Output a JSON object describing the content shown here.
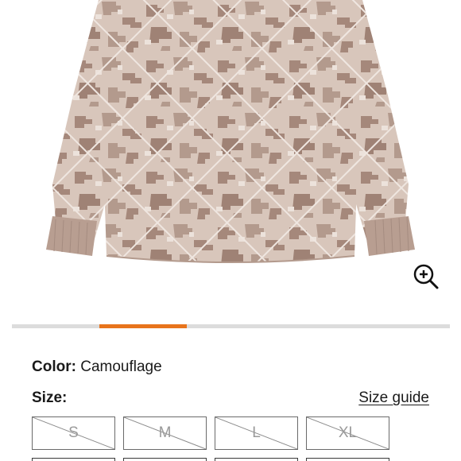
{
  "product": {
    "image_alt": "Quilted camouflage jacket",
    "colors": {
      "base": "#c9b3a7",
      "light": "#e3d5cc",
      "dark": "#a5887b",
      "cuff": "#b89e91",
      "accent": "#e8741c"
    }
  },
  "gallery": {
    "zoom_icon": "zoom-in-icon",
    "progress_fraction": 0.2
  },
  "color": {
    "label": "Color:",
    "value": "Camouflage"
  },
  "size": {
    "label": "Size:",
    "guide_link": "Size guide",
    "options": [
      {
        "label": "S",
        "available": false
      },
      {
        "label": "M",
        "available": false
      },
      {
        "label": "L",
        "available": false
      },
      {
        "label": "XL",
        "available": false
      }
    ]
  }
}
